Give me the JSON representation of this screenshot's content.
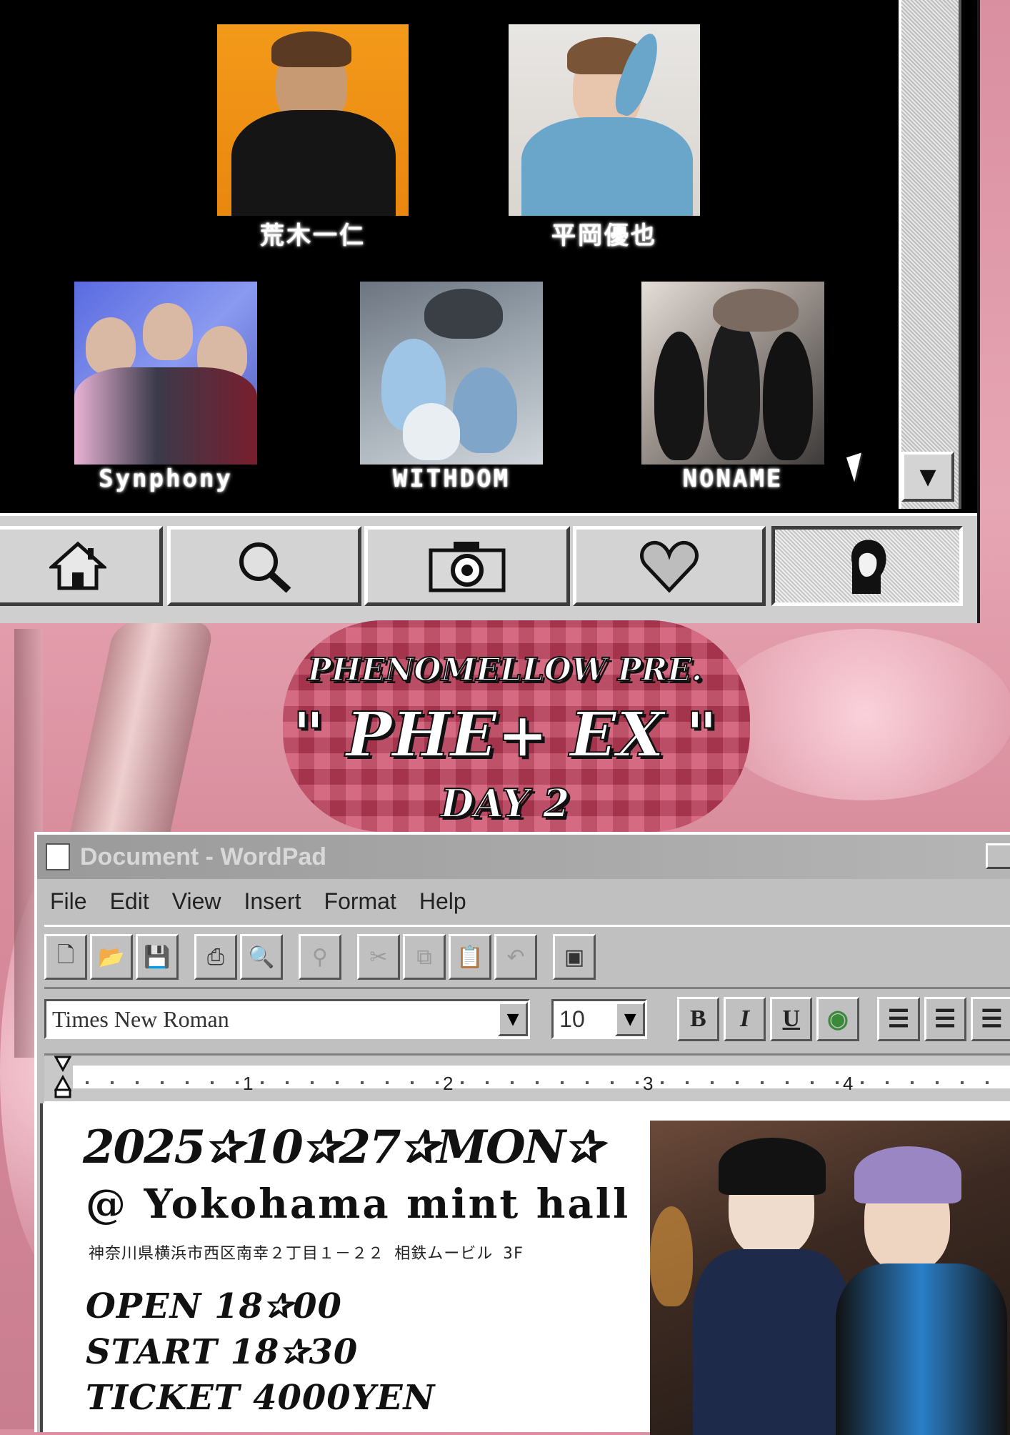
{
  "artists_row1": [
    {
      "name": "荒木一仁"
    },
    {
      "name": "平岡優也"
    }
  ],
  "artists_row2": [
    {
      "name": "Synphony"
    },
    {
      "name": "WITHDOM"
    },
    {
      "name": "NONAME"
    }
  ],
  "nav": {
    "icons": [
      "home-icon",
      "search-icon",
      "camera-icon",
      "heart-icon",
      "profile-icon"
    ]
  },
  "event_title": {
    "presenter": "PHENOMELLOW PRE.",
    "name": "\" PHE+ EX \"",
    "day": "DAY 2"
  },
  "wordpad": {
    "title": "Document - WordPad",
    "menu": [
      "File",
      "Edit",
      "View",
      "Insert",
      "Format",
      "Help"
    ],
    "font": "Times New Roman",
    "size": "10",
    "format_buttons": [
      "B",
      "I",
      "U"
    ],
    "ruler_numbers": [
      "1",
      "2",
      "3",
      "4"
    ]
  },
  "event": {
    "date": "2025✰10✰27✰MON✰",
    "venue": "@ Yokohama mint hall",
    "address": "神奈川県横浜市西区南幸２丁目１－２２ 相鉄ムービル 3F",
    "open": "OPEN 18✰00",
    "start": "START 18✰30",
    "ticket": "TICKET 4000YEN"
  },
  "colors": {
    "background_pink": "#d98fa0",
    "window_black": "#000000",
    "retro_gray": "#c0c0c0",
    "logo_red": "#c9405e"
  }
}
